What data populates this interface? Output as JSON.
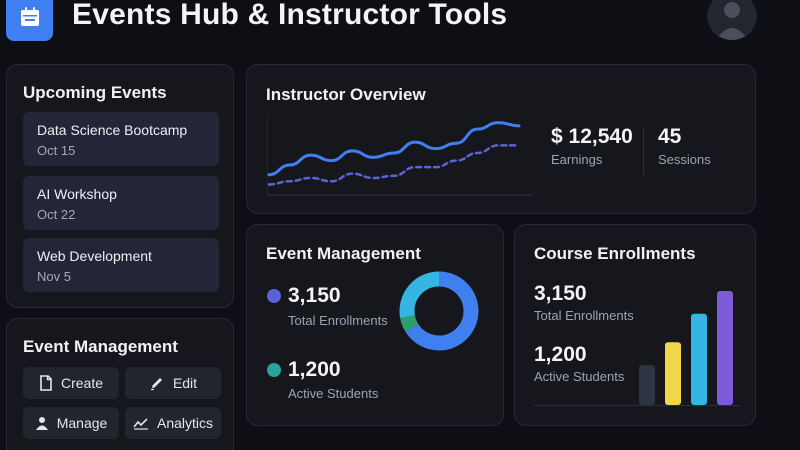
{
  "header": {
    "title": "Events Hub & Instructor Tools",
    "app_icon": "calendar-icon",
    "avatar_icon": "user-avatar-icon"
  },
  "upcoming_events": {
    "title": "Upcoming Events",
    "items": [
      {
        "name": "Data Science Bootcamp",
        "date": "Oct 15"
      },
      {
        "name": "AI Workshop",
        "date": "Oct 22"
      },
      {
        "name": "Web Development",
        "date": "Nov 5"
      }
    ]
  },
  "event_actions": {
    "title": "Event Management",
    "buttons": [
      {
        "label": "Create",
        "icon": "document-icon"
      },
      {
        "label": "Edit",
        "icon": "pencil-icon"
      },
      {
        "label": "Manage",
        "icon": "user-icon"
      },
      {
        "label": "Analytics",
        "icon": "analytics-icon"
      }
    ]
  },
  "instructor_overview": {
    "title": "Instructor Overview",
    "earnings_value": "$ 12,540",
    "earnings_label": "Earnings",
    "sessions_value": "45",
    "sessions_label": "Sessions"
  },
  "event_management_stats": {
    "title": "Event Management",
    "enrollments_value": "3,150",
    "enrollments_label": "Total Enrollments",
    "students_value": "1,200",
    "students_label": "Active Students"
  },
  "course_enrollments": {
    "title": "Course Enrollments",
    "enrollments_value": "3,150",
    "enrollments_label": "Total Enrollments",
    "students_value": "1,200",
    "students_label": "Active Students"
  },
  "colors": {
    "accent_blue": "#3f7ff0",
    "indigo": "#5b63d6",
    "teal": "#2aa39a",
    "cyan": "#35b5e2",
    "green": "#2e9e6a",
    "yellow": "#f1d84a",
    "purple": "#7d5ad8",
    "slate": "#2d3442"
  },
  "chart_data": [
    {
      "type": "line",
      "series": [
        {
          "values": [
            1.5,
            2.4,
            3.3,
            2.8,
            3.7,
            3.1,
            3.5,
            4.5,
            3.9,
            4.4,
            5.7,
            6.3,
            6.0
          ]
        },
        {
          "values": [
            0.6,
            0.9,
            1.2,
            0.9,
            1.6,
            1.2,
            1.4,
            2.2,
            2.2,
            2.8,
            3.5,
            4.2,
            4.2
          ]
        }
      ],
      "ylim": [
        0,
        7
      ],
      "grid": false
    },
    {
      "type": "pie",
      "donut": true,
      "values": [
        66,
        6,
        28
      ],
      "colors": [
        "#3f7ff0",
        "#2e9e6a",
        "#35b5e2"
      ]
    },
    {
      "type": "bar",
      "values": [
        35,
        55,
        80,
        100
      ],
      "colors": [
        "#2d3442",
        "#f1d84a",
        "#35b5e2",
        "#7d5ad8"
      ],
      "ylim": [
        0,
        100
      ]
    }
  ]
}
